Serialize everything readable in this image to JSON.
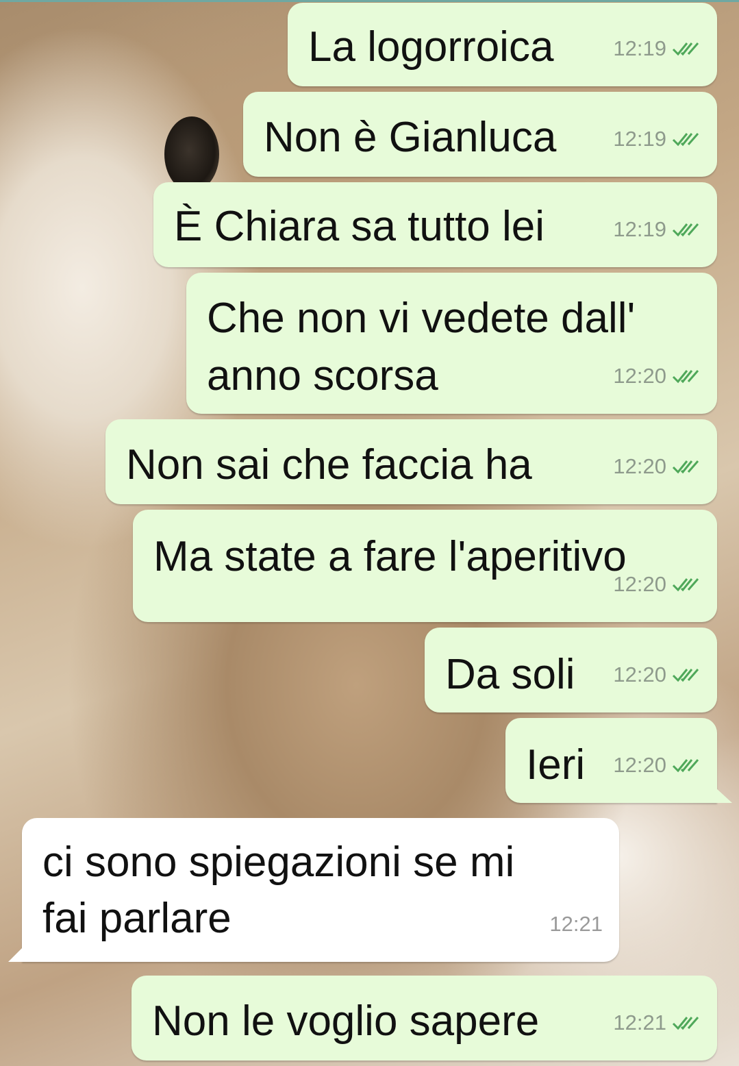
{
  "messages": [
    {
      "text": "La logorroica",
      "time": "12:19",
      "direction": "out"
    },
    {
      "text": "Non è Gianluca",
      "time": "12:19",
      "direction": "out"
    },
    {
      "text": "È Chiara sa tutto lei",
      "time": "12:19",
      "direction": "out"
    },
    {
      "line1": "Che non vi vedete dall'",
      "line2": "anno scorsa",
      "time": "12:20",
      "direction": "out"
    },
    {
      "text": "Non sai che faccia ha",
      "time": "12:20",
      "direction": "out"
    },
    {
      "text": "Ma state a fare l'aperitivo",
      "time": "12:20",
      "direction": "out"
    },
    {
      "text": "Da soli",
      "time": "12:20",
      "direction": "out"
    },
    {
      "text": "Ieri",
      "time": "12:20",
      "direction": "out"
    },
    {
      "line1": "ci sono spiegazioni se mi",
      "line2": "fai parlare",
      "time": "12:21",
      "direction": "in"
    },
    {
      "text": "Non le voglio sapere",
      "time": "12:21",
      "direction": "out"
    }
  ],
  "icons": {
    "read_receipt": "double-check-icon"
  },
  "colors": {
    "outgoing_bubble": "#e7fbd9",
    "incoming_bubble": "#ffffff",
    "read_ticks": "#4fa85a"
  }
}
